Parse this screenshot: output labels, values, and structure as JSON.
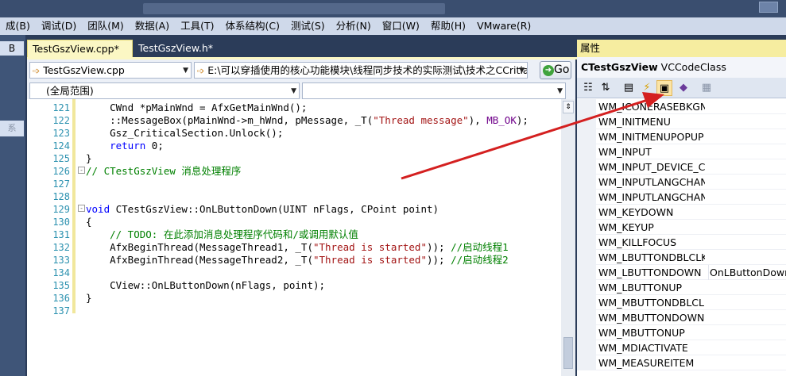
{
  "menu": [
    "成(B)",
    "调试(D)",
    "团队(M)",
    "数据(A)",
    "工具(T)",
    "体系结构(C)",
    "测试(S)",
    "分析(N)",
    "窗口(W)",
    "帮助(H)",
    "VMware(R)"
  ],
  "left_tabs": {
    "top": "B",
    "sub": "系"
  },
  "tabs": [
    {
      "label": "TestGszView.cpp*",
      "active": true
    },
    {
      "label": "TestGszView.h*",
      "active": false
    }
  ],
  "nav": {
    "class_combo": "TestGszView.cpp",
    "member_combo": "E:\\可以穿插使用的核心功能模块\\线程同步技术的实际测试\\技术之CCritiac",
    "go_label": "Go",
    "scope_combo": "(全局范围)",
    "scope_combo2": ""
  },
  "code": [
    {
      "n": "121",
      "fold": "",
      "parts": [
        [
          "",
          "    CWnd *pMainWnd = AfxGetMainWnd();"
        ]
      ]
    },
    {
      "n": "122",
      "fold": "",
      "parts": [
        [
          "",
          "    ::MessageBox(pMainWnd->m_hWnd, pMessage, _T("
        ],
        [
          "s",
          "\"Thread message\""
        ],
        [
          "",
          "), "
        ],
        [
          "m",
          "MB_OK"
        ],
        [
          "",
          ");"
        ]
      ]
    },
    {
      "n": "123",
      "fold": "",
      "parts": [
        [
          "",
          "    Gsz_CriticalSection.Unlock();"
        ]
      ]
    },
    {
      "n": "124",
      "fold": "",
      "parts": [
        [
          "k",
          "    return"
        ],
        [
          "",
          " 0;"
        ]
      ]
    },
    {
      "n": "125",
      "fold": "",
      "parts": [
        [
          "",
          "}"
        ]
      ]
    },
    {
      "n": "126",
      "fold": "-",
      "parts": [
        [
          "c",
          "// CTestGszView 消息处理程序"
        ]
      ]
    },
    {
      "n": "127",
      "fold": "",
      "parts": [
        [
          "",
          ""
        ]
      ]
    },
    {
      "n": "128",
      "fold": "",
      "parts": [
        [
          "",
          ""
        ]
      ]
    },
    {
      "n": "129",
      "fold": "-",
      "parts": [
        [
          "k",
          "void"
        ],
        [
          "",
          " CTestGszView::OnLButtonDown(UINT nFlags, CPoint point)"
        ]
      ]
    },
    {
      "n": "130",
      "fold": "",
      "parts": [
        [
          "",
          "{"
        ]
      ]
    },
    {
      "n": "131",
      "fold": "",
      "parts": [
        [
          "c",
          "    // TODO: 在此添加消息处理程序代码和/或调用默认值"
        ]
      ]
    },
    {
      "n": "132",
      "fold": "",
      "parts": [
        [
          "",
          "    AfxBeginThread(MessageThread1, _T("
        ],
        [
          "s",
          "\"Thread is started\""
        ],
        [
          "",
          "));"
        ],
        [
          "c",
          " //启动线程1"
        ]
      ]
    },
    {
      "n": "133",
      "fold": "",
      "parts": [
        [
          "",
          "    AfxBeginThread(MessageThread2, _T("
        ],
        [
          "s",
          "\"Thread is started\""
        ],
        [
          "",
          "));"
        ],
        [
          "c",
          " //启动线程2"
        ]
      ]
    },
    {
      "n": "134",
      "fold": "",
      "parts": [
        [
          "",
          ""
        ]
      ]
    },
    {
      "n": "135",
      "fold": "",
      "parts": [
        [
          "",
          "    CView::OnLButtonDown(nFlags, point);"
        ]
      ]
    },
    {
      "n": "136",
      "fold": "",
      "parts": [
        [
          "",
          "}"
        ]
      ]
    },
    {
      "n": "137",
      "fold": "",
      "parts": [
        [
          "",
          ""
        ]
      ]
    }
  ],
  "properties": {
    "title": "属性",
    "object_name": "CTestGszView",
    "object_type": "VCCodeClass",
    "rows": [
      {
        "name": "WM_ICONERASEBKGN",
        "value": ""
      },
      {
        "name": "WM_INITMENU",
        "value": ""
      },
      {
        "name": "WM_INITMENUPOPUP",
        "value": ""
      },
      {
        "name": "WM_INPUT",
        "value": ""
      },
      {
        "name": "WM_INPUT_DEVICE_CH",
        "value": ""
      },
      {
        "name": "WM_INPUTLANGCHAN",
        "value": ""
      },
      {
        "name": "WM_INPUTLANGCHAN",
        "value": ""
      },
      {
        "name": "WM_KEYDOWN",
        "value": ""
      },
      {
        "name": "WM_KEYUP",
        "value": ""
      },
      {
        "name": "WM_KILLFOCUS",
        "value": ""
      },
      {
        "name": "WM_LBUTTONDBLCLK",
        "value": ""
      },
      {
        "name": "WM_LBUTTONDOWN",
        "value": "OnLButtonDown"
      },
      {
        "name": "WM_LBUTTONUP",
        "value": ""
      },
      {
        "name": "WM_MBUTTONDBLCLK",
        "value": ""
      },
      {
        "name": "WM_MBUTTONDOWN",
        "value": ""
      },
      {
        "name": "WM_MBUTTONUP",
        "value": ""
      },
      {
        "name": "WM_MDIACTIVATE",
        "value": ""
      },
      {
        "name": "WM_MEASUREITEM",
        "value": ""
      }
    ]
  },
  "toolbar_icons": [
    "categorized-icon",
    "alphabetical-icon",
    "properties-icon",
    "events-icon",
    "messages-icon",
    "overrides-icon",
    "property-pages-icon"
  ],
  "colors": {
    "keyword": "#0000ff",
    "comment": "#008000",
    "string": "#a31515",
    "macro": "#6f008a",
    "line_number": "#2b91af",
    "arrow": "#d42020"
  }
}
